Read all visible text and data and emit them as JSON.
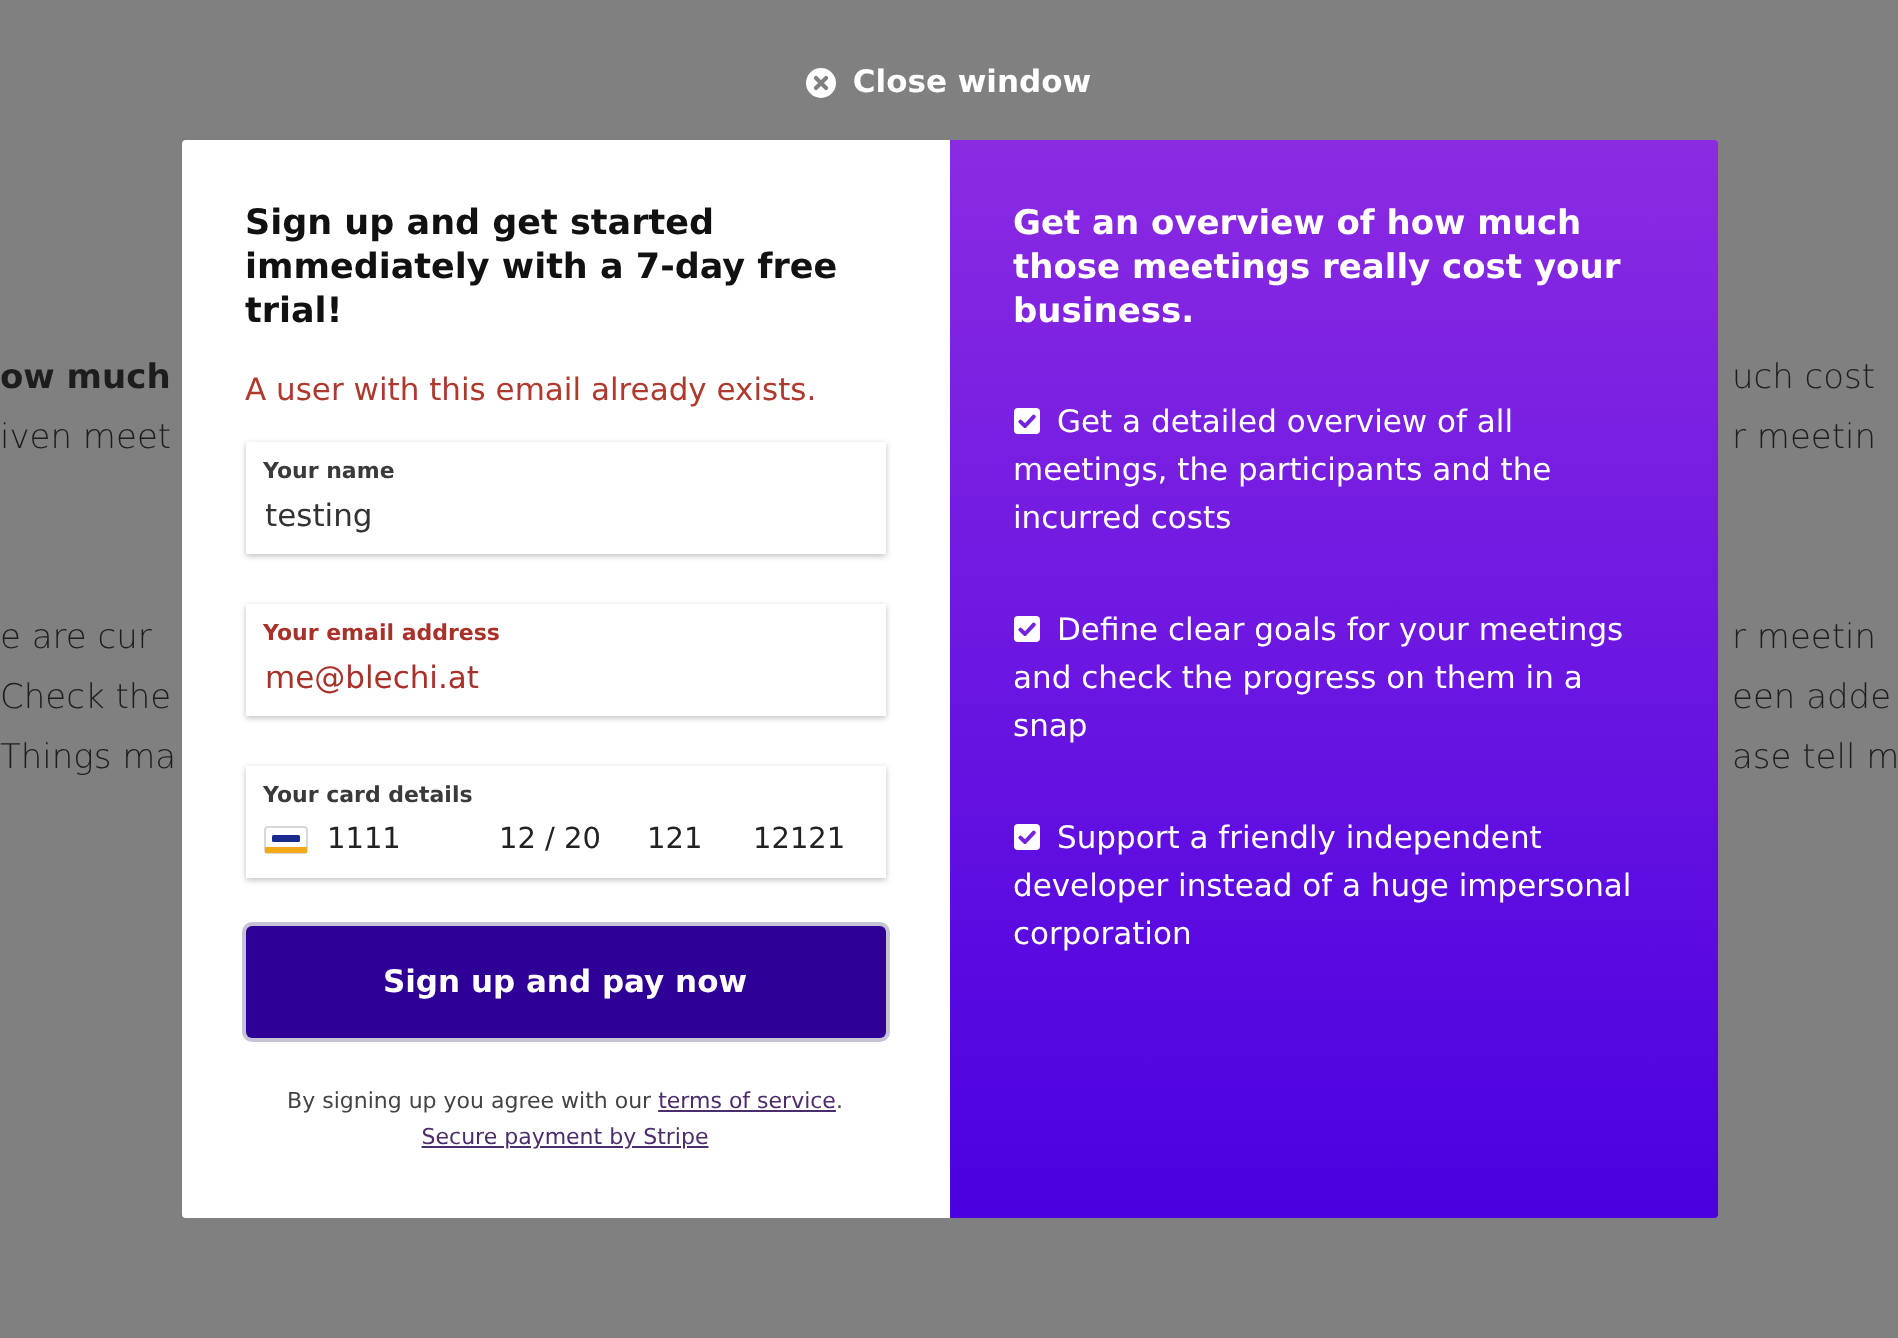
{
  "background_page": {
    "left_column": [
      {
        "lines": [
          {
            "kind": "heading",
            "text": "ow much"
          },
          {
            "kind": "text",
            "text": "iven meet"
          }
        ]
      },
      {
        "lines": [
          {
            "kind": "text",
            "text": "e are cur"
          },
          {
            "kind": "text",
            "text": "Check the"
          },
          {
            "kind": "text",
            "text": "Things ma"
          }
        ]
      }
    ],
    "right_column": [
      {
        "lines": [
          {
            "kind": "text",
            "text": "uch cost"
          },
          {
            "kind": "text",
            "text": "r meetin"
          }
        ]
      },
      {
        "lines": [
          {
            "kind": "text",
            "text": "r meetin"
          },
          {
            "kind": "text",
            "text": "een adde"
          },
          {
            "kind": "text",
            "text": "ase tell m"
          }
        ]
      }
    ]
  },
  "close_button": {
    "label": "Close window"
  },
  "signup_panel": {
    "title": "Sign up and get started immediately with a 7-day free trial!",
    "error_message": "A user with this email already exists.",
    "fields": [
      {
        "label": "Your name",
        "value": "testing",
        "error": false
      },
      {
        "label": "Your email address",
        "value": "me@blechi.at",
        "error": true
      }
    ],
    "card_field": {
      "label": "Your card details",
      "number": "1111",
      "expiry": "12 / 20",
      "cvc": "121",
      "postal_code": "12121"
    },
    "submit_button": {
      "label": "Sign up and pay now",
      "focused": true
    },
    "terms_text": {
      "before": "By signing up you agree with our ",
      "link": "terms of service",
      "after": "."
    },
    "payment_link": "Secure payment by Stripe"
  },
  "info_panel": {
    "title": "Get an overview of how much those meetings really cost your business.",
    "features": [
      {
        "text": "Get a detailed overview of all meetings, the participants and the incurred costs",
        "checked": true
      },
      {
        "text": "Define clear goals for your meetings and check the progress on them in a snap",
        "checked": true
      },
      {
        "text": "Support a friendly independent developer instead of a huge impersonal corporation",
        "checked": true
      }
    ]
  }
}
